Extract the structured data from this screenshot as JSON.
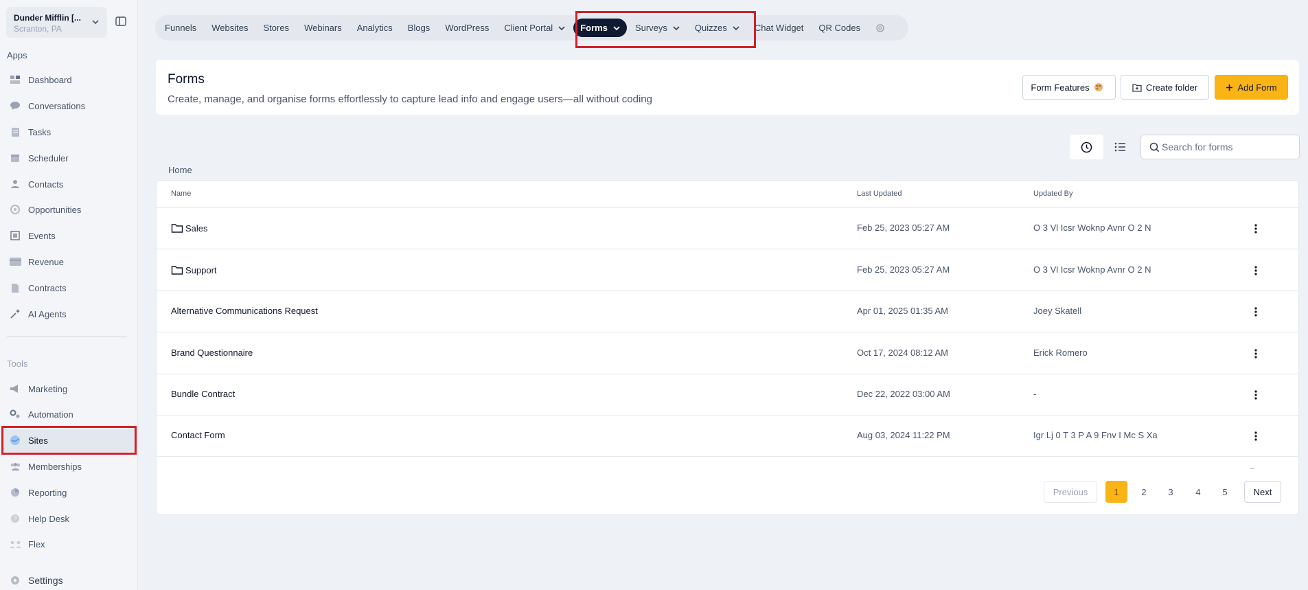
{
  "location": {
    "name": "Dunder Mifflin [...",
    "city": "Scranton, PA"
  },
  "sidebar": {
    "apps_label": "Apps",
    "tools_label": "Tools",
    "apps": [
      {
        "label": "Dashboard",
        "icon": "dashboard-icon"
      },
      {
        "label": "Conversations",
        "icon": "chat-icon"
      },
      {
        "label": "Tasks",
        "icon": "tasks-icon"
      },
      {
        "label": "Scheduler",
        "icon": "calendar-icon"
      },
      {
        "label": "Contacts",
        "icon": "contacts-icon"
      },
      {
        "label": "Opportunities",
        "icon": "opportunities-icon"
      },
      {
        "label": "Events",
        "icon": "events-icon"
      },
      {
        "label": "Revenue",
        "icon": "revenue-icon"
      },
      {
        "label": "Contracts",
        "icon": "contracts-icon"
      },
      {
        "label": "AI Agents",
        "icon": "ai-agents-icon"
      }
    ],
    "tools": [
      {
        "label": "Marketing",
        "icon": "marketing-icon"
      },
      {
        "label": "Automation",
        "icon": "automation-icon"
      },
      {
        "label": "Sites",
        "icon": "sites-icon",
        "active": true
      },
      {
        "label": "Memberships",
        "icon": "memberships-icon"
      },
      {
        "label": "Reporting",
        "icon": "reporting-icon"
      },
      {
        "label": "Help Desk",
        "icon": "help-desk-icon"
      },
      {
        "label": "Flex",
        "icon": "flex-icon"
      }
    ],
    "settings_label": "Settings"
  },
  "topnav": {
    "items": [
      "Funnels",
      "Websites",
      "Stores",
      "Webinars",
      "Analytics",
      "Blogs",
      "WordPress",
      "Client Portal",
      "Forms",
      "Surveys",
      "Quizzes",
      "Chat Widget",
      "QR Codes"
    ],
    "active": "Forms"
  },
  "header": {
    "title": "Forms",
    "subtitle": "Create, manage, and organise forms effortlessly to capture lead info and engage users—all without coding",
    "features_label": "Form Features",
    "create_folder_label": "Create folder",
    "add_form_label": "Add Form"
  },
  "search": {
    "placeholder": "Search for forms"
  },
  "breadcrumb": "Home",
  "table": {
    "columns": [
      "Name",
      "Last Updated",
      "Updated By"
    ],
    "rows": [
      {
        "name": "Sales",
        "folder": true,
        "updated": "Feb 25, 2023 05:27 AM",
        "by": "O 3 Vl Icsr Woknp Avnr O 2 N"
      },
      {
        "name": "Support",
        "folder": true,
        "updated": "Feb 25, 2023 05:27 AM",
        "by": "O 3 Vl Icsr Woknp Avnr O 2 N"
      },
      {
        "name": "Alternative Communications Request",
        "folder": false,
        "updated": "Apr 01, 2025 01:35 AM",
        "by": "Joey Skatell"
      },
      {
        "name": "Brand Questionnaire",
        "folder": false,
        "updated": "Oct 17, 2024 08:12 AM",
        "by": "Erick Romero"
      },
      {
        "name": "Bundle Contract",
        "folder": false,
        "updated": "Dec 22, 2022 03:00 AM",
        "by": "-"
      },
      {
        "name": "Contact Form",
        "folder": false,
        "updated": "Aug 03, 2024 11:22 PM",
        "by": "Igr Lj 0 T 3 P A 9 Fnv I Mc S Xa"
      }
    ]
  },
  "pagination": {
    "previous": "Previous",
    "pages": [
      "1",
      "2",
      "3",
      "4",
      "5"
    ],
    "current": "1",
    "next": "Next"
  },
  "colors": {
    "accent": "#fbb415",
    "nav_active": "#101a33",
    "highlight": "#d0202a"
  }
}
